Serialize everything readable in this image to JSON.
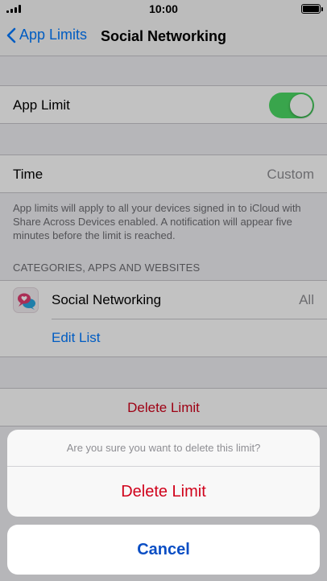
{
  "status": {
    "time": "10:00"
  },
  "nav": {
    "back_label": "App Limits",
    "title": "Social Networking"
  },
  "app_limit": {
    "label": "App Limit",
    "enabled": true
  },
  "time_row": {
    "label": "Time",
    "value": "Custom"
  },
  "footer_note": "App limits will apply to all your devices signed in to iCloud with Share Across Devices enabled. A notification will appear five minutes before the limit is reached.",
  "section_header": "CATEGORIES, APPS AND WEBSITES",
  "category": {
    "label": "Social Networking",
    "value": "All"
  },
  "edit_list_label": "Edit List",
  "delete_row_label": "Delete Limit",
  "action_sheet": {
    "message": "Are you sure you want to delete this limit?",
    "destructive_label": "Delete Limit",
    "cancel_label": "Cancel"
  },
  "colors": {
    "accent": "#007aff",
    "destructive": "#d0021b",
    "toggle_on": "#4cd964",
    "cancel": "#0a4ec4"
  }
}
